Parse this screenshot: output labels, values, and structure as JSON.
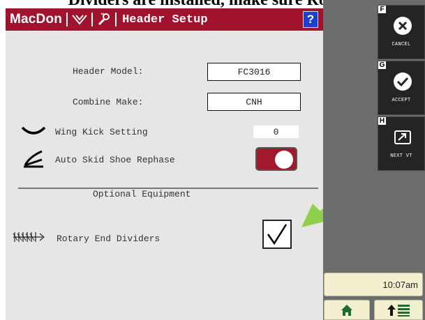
{
  "caption": "Dividers are installed, make sure Rotary",
  "header": {
    "brand": "MacDon",
    "title": "Header Setup",
    "help_label": "?"
  },
  "form": {
    "header_model_label": "Header Model:",
    "header_model_value": "FC3016",
    "combine_make_label": "Combine Make:",
    "combine_make_value": "CNH",
    "wing_kick_label": "Wing Kick Setting",
    "wing_kick_value": "0",
    "auto_skid_label": "Auto Skid Shoe Rephase",
    "auto_skid_enabled": true
  },
  "optional": {
    "section_label": "Optional Equipment",
    "rotary_label": "Rotary End Dividers",
    "rotary_checked": true,
    "check_glyph": "✓"
  },
  "softkeys": [
    {
      "letter": "F",
      "label": "CANCEL",
      "icon": "cancel-x-icon"
    },
    {
      "letter": "G",
      "label": "ACCEPT",
      "icon": "accept-check-icon"
    },
    {
      "letter": "H",
      "label": "NEXT VT",
      "icon": "next-vt-icon"
    }
  ],
  "status": {
    "time": "10:07am"
  },
  "colors": {
    "brand_red": "#a1122c",
    "screen_bg": "#e6e6e6",
    "panel_gray": "#6b6d6d",
    "softkey_bg": "#242424",
    "clock_bg": "#f2f0cf",
    "help_blue": "#1b3fd3",
    "arrow_green": "#8fcf4a"
  }
}
